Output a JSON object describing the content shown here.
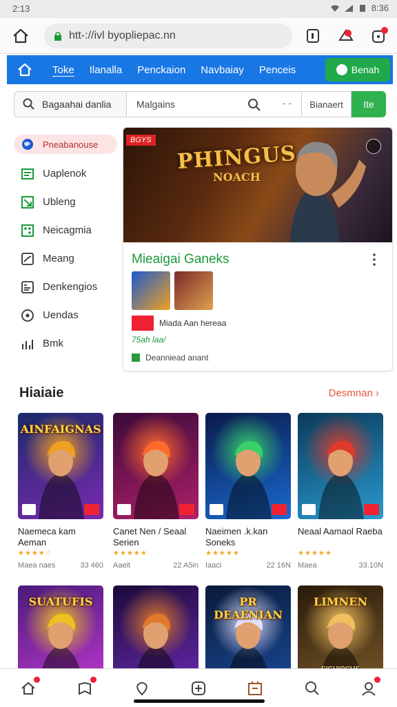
{
  "status": {
    "time": "2:13",
    "clock_right": "8:36"
  },
  "browser": {
    "url": "htt-://ivl byopliepac.nn"
  },
  "nav": {
    "items": [
      "Toke",
      "Ilanalla",
      "Penckaion",
      "Navbaiay",
      "Penceis"
    ],
    "button_label": "Benah"
  },
  "search": {
    "left_placeholder": "Bagaahai danlia",
    "main_placeholder": "Malgains",
    "dash": "- -",
    "filter_label": "Bianaert",
    "go_label": "Ite"
  },
  "sidebar": {
    "items": [
      {
        "label": "Pneabanouse",
        "icon": "globe-icon"
      },
      {
        "label": "Uaplenok",
        "icon": "list-icon"
      },
      {
        "label": "Ubleng",
        "icon": "chart-icon"
      },
      {
        "label": "Neicagmia",
        "icon": "grid-icon"
      },
      {
        "label": "Meang",
        "icon": "trend-icon"
      },
      {
        "label": "Denkengios",
        "icon": "doc-icon"
      },
      {
        "label": "Uendas",
        "icon": "compass-icon"
      },
      {
        "label": "Bmk",
        "icon": "bar-chart-icon"
      }
    ]
  },
  "featured": {
    "tag": "BGYS",
    "banner_title": "PHINGUS",
    "banner_subtitle": "NOACH",
    "title": "Mieaigai Ganeks",
    "meta": "Miada Aan hereaa",
    "price": "75ah laa/",
    "download": "Deanniead anant"
  },
  "section": {
    "title": "Hiaiaie",
    "see_more": "Desmnan"
  },
  "games": [
    {
      "art_title": "AINFAIGNAS",
      "name": "Naemeca kam Aeman",
      "stars": "★★★★☆",
      "left": "Maea naes",
      "right": "33 460",
      "c1": "#1b2a6a",
      "c2": "#7a2ab0",
      "c3": "#f0a020"
    },
    {
      "art_title": "",
      "name": "Canet Nen / Seaal Serien",
      "stars": "★★★★★",
      "left": "Aaeit",
      "right": "22 A5in",
      "c1": "#3a0a3a",
      "c2": "#b0206a",
      "c3": "#ff6a2a"
    },
    {
      "art_title": "",
      "name": "Naeimen .k.kan Soneks",
      "stars": "★★★★★",
      "left": "Iaaci",
      "right": "22 16N",
      "c1": "#0a1a4a",
      "c2": "#1a6ad0",
      "c3": "#3ad06a"
    },
    {
      "art_title": "",
      "name": "Neaal Aamaol Raeba",
      "stars": "★★★★★",
      "left": "Maea",
      "right": "33.10N",
      "c1": "#0a3a5a",
      "c2": "#2a9ad0",
      "c3": "#e03a2a"
    },
    {
      "art_title": "SUATUFIS",
      "name": "",
      "stars": "",
      "left": "",
      "right": "",
      "c1": "#4a1a7a",
      "c2": "#c03ad0",
      "c3": "#f0c020"
    },
    {
      "art_title": "",
      "name": "",
      "stars": "",
      "left": "",
      "right": "",
      "c1": "#1a0a3a",
      "c2": "#6a2ab0",
      "c3": "#e07a2a"
    },
    {
      "art_title": "PR DEAENIAN",
      "name": "",
      "stars": "",
      "left": "",
      "right": "",
      "c1": "#0a1a3a",
      "c2": "#1a4a9a",
      "c3": "#e0e0ff"
    },
    {
      "art_title": "LIMNEN",
      "name": "",
      "stars": "",
      "left": "",
      "right": "",
      "c1": "#2a1a0a",
      "c2": "#7a5a2a",
      "c3": "#f0c060"
    }
  ],
  "last_card_caption": "SIGUIOCUS",
  "colors": {
    "brand_blue": "#1977e4",
    "accent_green": "#20a84a",
    "accent_red": "#e23333"
  }
}
